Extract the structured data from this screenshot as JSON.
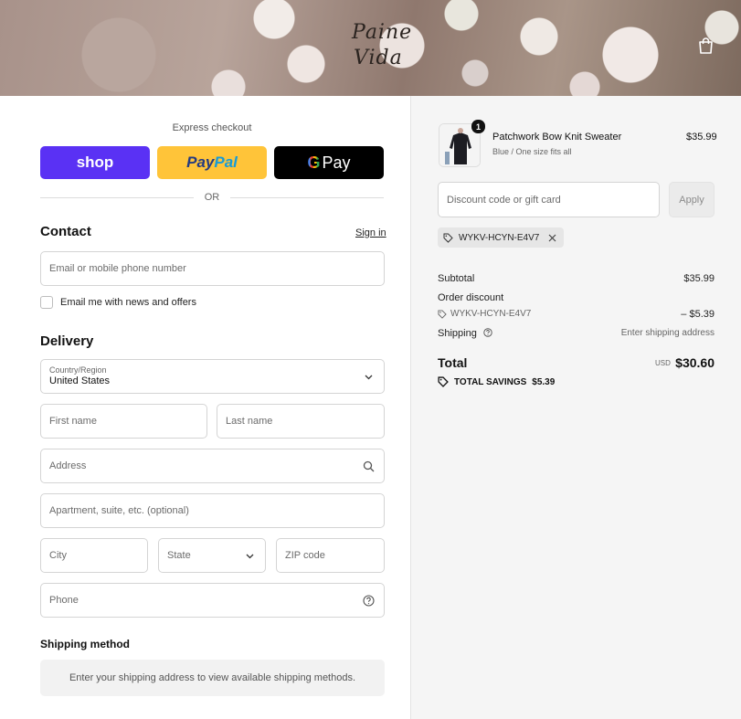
{
  "header": {
    "brand_line1": "Paine",
    "brand_line2": "Vida"
  },
  "express": {
    "label": "Express checkout",
    "shop_label": "shop",
    "paypal_part1": "Pay",
    "paypal_part2": "Pal",
    "gpay_g": "G",
    "gpay_label": "Pay",
    "or_label": "OR"
  },
  "contact": {
    "title": "Contact",
    "signin_label": "Sign in",
    "email_placeholder": "Email or mobile phone number",
    "newsletter_label": "Email me with news and offers"
  },
  "delivery": {
    "title": "Delivery",
    "country_label": "Country/Region",
    "country_value": "United States",
    "first_name_placeholder": "First name",
    "last_name_placeholder": "Last name",
    "address_placeholder": "Address",
    "apartment_placeholder": "Apartment, suite, etc. (optional)",
    "city_placeholder": "City",
    "state_label": "State",
    "zip_placeholder": "ZIP code",
    "phone_placeholder": "Phone"
  },
  "shipping": {
    "title": "Shipping method",
    "hint": "Enter your shipping address to view available shipping methods."
  },
  "summary": {
    "product": {
      "quantity": "1",
      "name": "Patchwork Bow Knit Sweater",
      "variant": "Blue / One size fits all",
      "price": "$35.99"
    },
    "discount_placeholder": "Discount code or gift card",
    "apply_label": "Apply",
    "code": "WYKV-HCYN-E4V7",
    "subtotal_label": "Subtotal",
    "subtotal_value": "$35.99",
    "order_discount_label": "Order discount",
    "discount_code": "WYKV-HCYN-E4V7",
    "discount_value": "– $5.39",
    "shipping_label": "Shipping",
    "shipping_value": "Enter shipping address",
    "total_label": "Total",
    "total_currency": "USD",
    "total_value": "$30.60",
    "savings_label": "TOTAL SAVINGS",
    "savings_value": "$5.39"
  },
  "colors": {
    "shop_brand": "#5a31f4",
    "paypal_yellow": "#ffc439",
    "gpay_black": "#000000",
    "summary_bg": "#f5f5f5"
  }
}
